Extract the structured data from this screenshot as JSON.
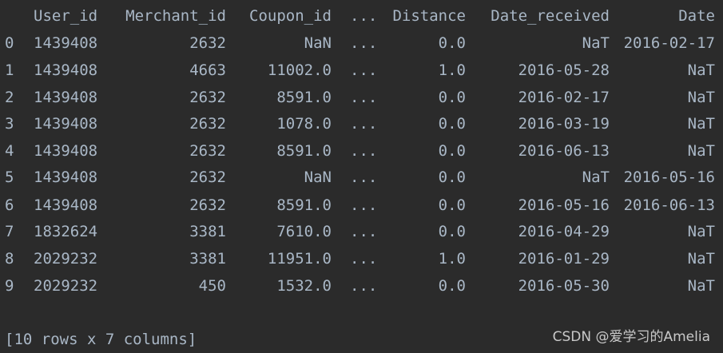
{
  "table": {
    "header": {
      "index": "",
      "user_id": "User_id",
      "merchant_id": "Merchant_id",
      "coupon_id": "Coupon_id",
      "ellipsis": "...",
      "distance": "Distance",
      "date_received": "Date_received",
      "date": "Date"
    },
    "rows": [
      {
        "index": "0",
        "user_id": "1439408",
        "merchant_id": "2632",
        "coupon_id": "NaN",
        "ellipsis": "...",
        "distance": "0.0",
        "date_received": "NaT",
        "date": "2016-02-17"
      },
      {
        "index": "1",
        "user_id": "1439408",
        "merchant_id": "4663",
        "coupon_id": "11002.0",
        "ellipsis": "...",
        "distance": "1.0",
        "date_received": "2016-05-28",
        "date": "NaT"
      },
      {
        "index": "2",
        "user_id": "1439408",
        "merchant_id": "2632",
        "coupon_id": "8591.0",
        "ellipsis": "...",
        "distance": "0.0",
        "date_received": "2016-02-17",
        "date": "NaT"
      },
      {
        "index": "3",
        "user_id": "1439408",
        "merchant_id": "2632",
        "coupon_id": "1078.0",
        "ellipsis": "...",
        "distance": "0.0",
        "date_received": "2016-03-19",
        "date": "NaT"
      },
      {
        "index": "4",
        "user_id": "1439408",
        "merchant_id": "2632",
        "coupon_id": "8591.0",
        "ellipsis": "...",
        "distance": "0.0",
        "date_received": "2016-06-13",
        "date": "NaT"
      },
      {
        "index": "5",
        "user_id": "1439408",
        "merchant_id": "2632",
        "coupon_id": "NaN",
        "ellipsis": "...",
        "distance": "0.0",
        "date_received": "NaT",
        "date": "2016-05-16"
      },
      {
        "index": "6",
        "user_id": "1439408",
        "merchant_id": "2632",
        "coupon_id": "8591.0",
        "ellipsis": "...",
        "distance": "0.0",
        "date_received": "2016-05-16",
        "date": "2016-06-13"
      },
      {
        "index": "7",
        "user_id": "1832624",
        "merchant_id": "3381",
        "coupon_id": "7610.0",
        "ellipsis": "...",
        "distance": "0.0",
        "date_received": "2016-04-29",
        "date": "NaT"
      },
      {
        "index": "8",
        "user_id": "2029232",
        "merchant_id": "3381",
        "coupon_id": "11951.0",
        "ellipsis": "...",
        "distance": "1.0",
        "date_received": "2016-01-29",
        "date": "NaT"
      },
      {
        "index": "9",
        "user_id": "2029232",
        "merchant_id": "450",
        "coupon_id": "1532.0",
        "ellipsis": "...",
        "distance": "0.0",
        "date_received": "2016-05-30",
        "date": "NaT"
      }
    ]
  },
  "summary": "[10 rows x 7 columns]",
  "watermark": "CSDN @爱学习的Amelia",
  "colors": {
    "background": "#2b2b2b",
    "text": "#a9b7c6",
    "watermark": "#c9c9c9"
  }
}
